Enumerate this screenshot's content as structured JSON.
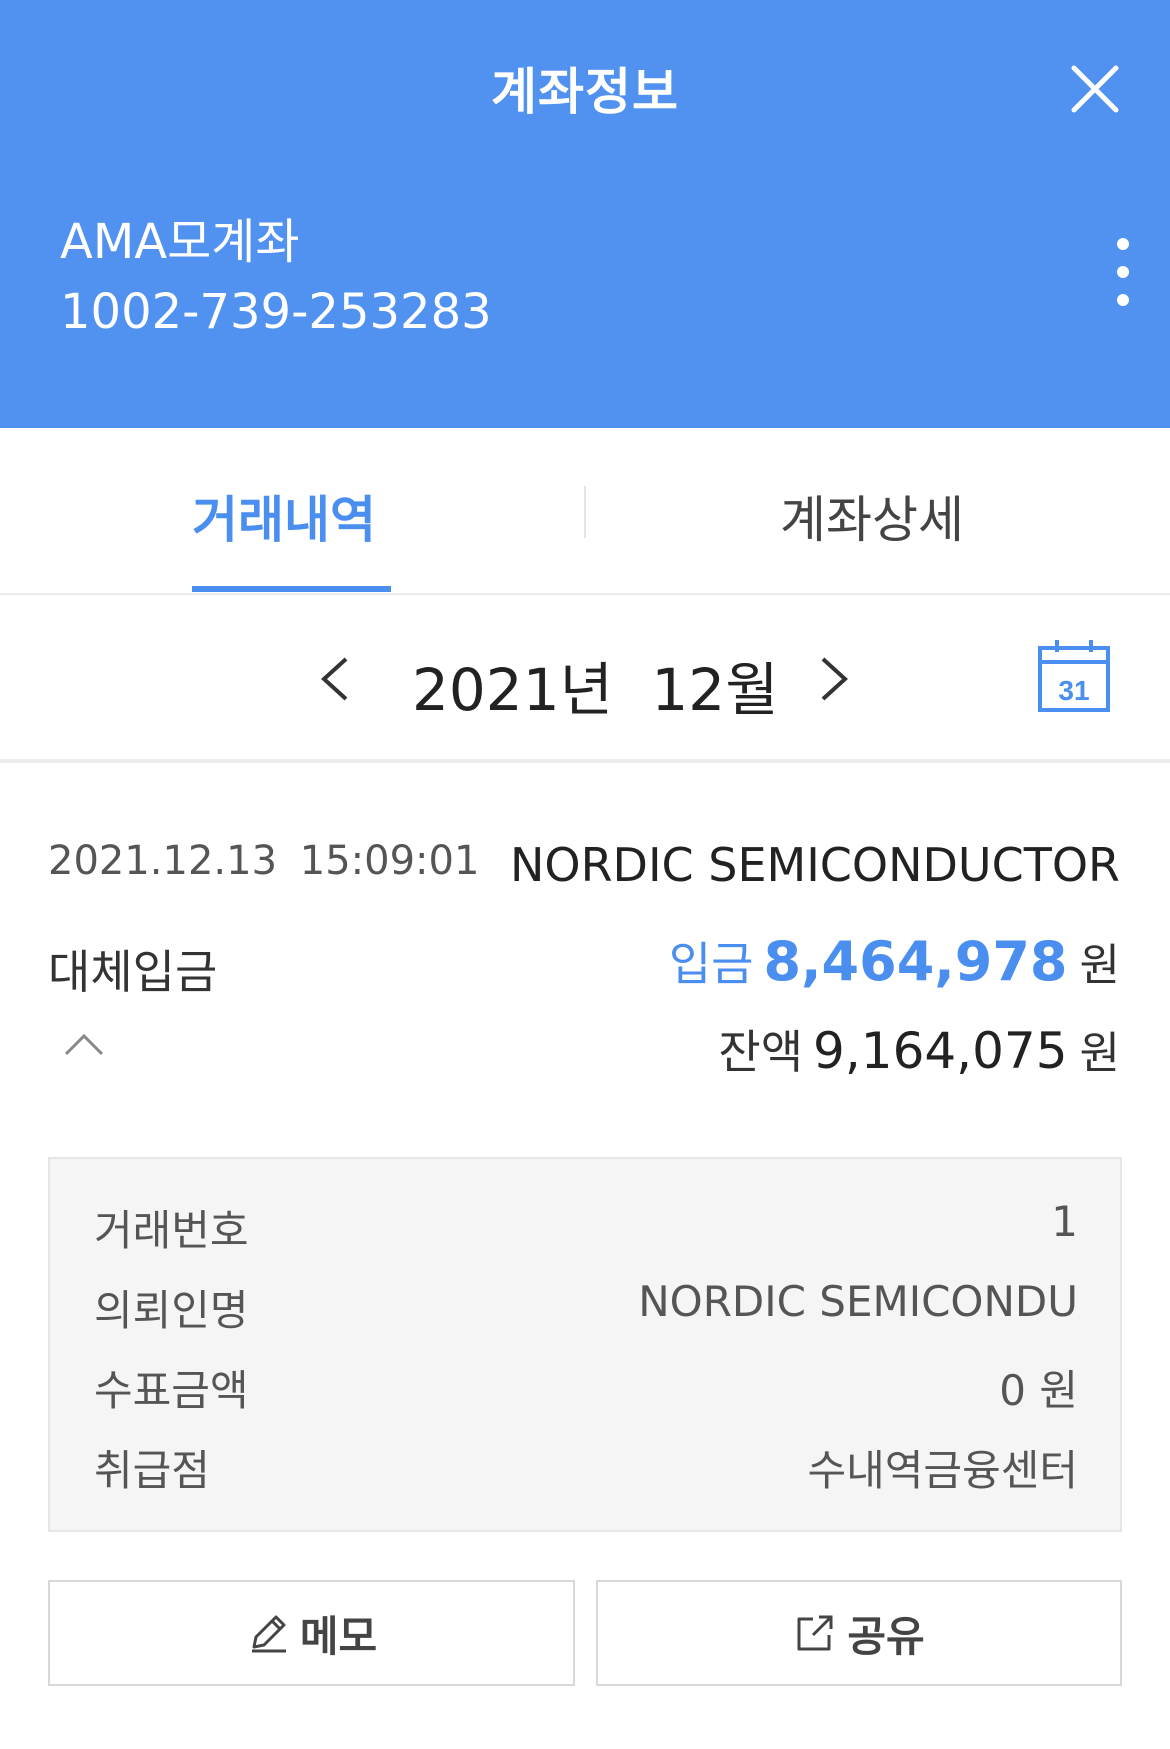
{
  "header": {
    "title": "계좌정보",
    "account_name": "AMA모계좌",
    "account_number": "1002-739-253283"
  },
  "tabs": [
    {
      "label": "거래내역",
      "active": true
    },
    {
      "label": "계좌상세",
      "active": false
    }
  ],
  "period": {
    "label": "2021년 12월"
  },
  "calendar": {
    "day": "31"
  },
  "transaction": {
    "datetime": "2021.12.13 15:09:01",
    "counterparty": "NORDIC SEMICONDUCTOR",
    "type": "대체입금",
    "deposit_label": "입금",
    "deposit_amount": "8,464,978",
    "currency": "원",
    "balance_label": "잔액",
    "balance_amount": "9,164,075"
  },
  "details": [
    {
      "label": "거래번호",
      "value": "1"
    },
    {
      "label": "의뢰인명",
      "value": "NORDIC SEMICONDU"
    },
    {
      "label": "수표금액",
      "value": "0 원"
    },
    {
      "label": "취급점",
      "value": "수내역금융센터"
    }
  ],
  "actions": {
    "memo_label": "메모",
    "share_label": "공유"
  },
  "colors": {
    "header_bg": "#5191ef",
    "accent": "#4a8ef0"
  }
}
